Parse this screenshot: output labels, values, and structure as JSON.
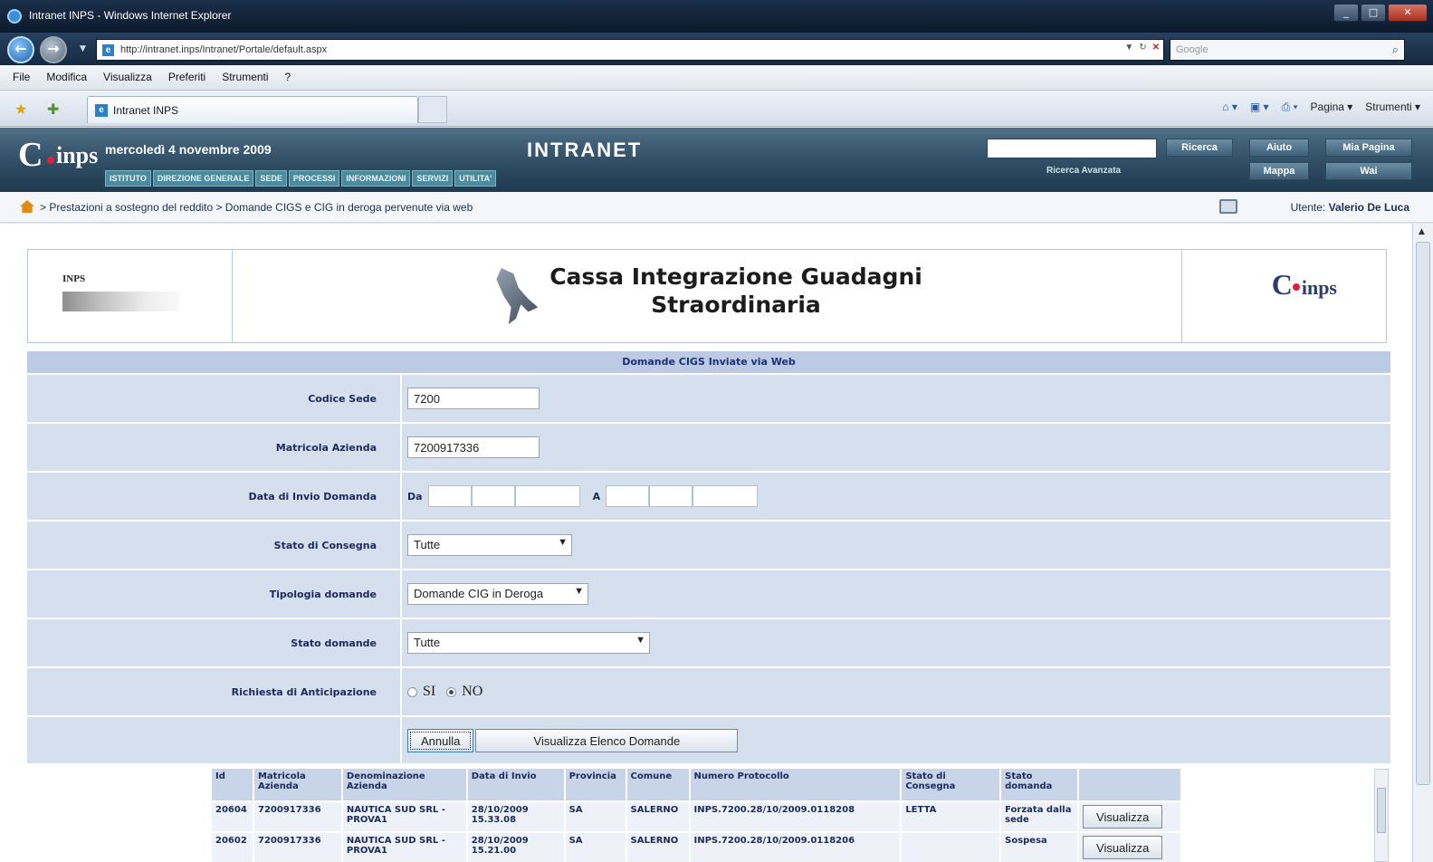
{
  "browser": {
    "window_title": "Intranet INPS - Windows Internet Explorer",
    "url": "http://intranet.inps/Intranet/Portale/default.aspx",
    "search_placeholder": "Google",
    "menu": [
      "File",
      "Modifica",
      "Visualizza",
      "Preferiti",
      "Strumenti",
      "?"
    ],
    "tab_label": "Intranet INPS",
    "command_bar": [
      "Pagina ▾",
      "Strumenti ▾"
    ]
  },
  "header": {
    "logo_text": "e-inps",
    "date": "mercoledì 4 novembre 2009",
    "title": "INTRANET",
    "nav": [
      "ISTITUTO",
      "DIREZIONE GENERALE",
      "SEDE",
      "PROCESSI",
      "INFORMAZIONI",
      "SERVIZI",
      "UTILITA'"
    ],
    "search_button": "Ricerca",
    "advanced_search": "Ricerca Avanzata",
    "help": "Aiuto",
    "my_page": "Mia Pagina",
    "map": "Mappa",
    "wai": "Wai"
  },
  "breadcrumb": {
    "path": "> Prestazioni a sostegno del reddito > Domande CIGS e CIG in deroga pervenute via web",
    "user_label": "Utente:",
    "user_name": "Valerio De Luca"
  },
  "banner": {
    "left_logo_text": "INPS",
    "title_line1": "Cassa Integrazione Guadagni",
    "title_line2": "Straordinaria",
    "right_logo_text": "e-inps"
  },
  "form": {
    "heading": "Domande CIGS Inviate via Web",
    "codice_sede_label": "Codice Sede",
    "codice_sede_value": "7200",
    "matricola_label": "Matricola Azienda",
    "matricola_value": "7200917336",
    "data_invio_label": "Data di Invio Domanda",
    "da_label": "Da",
    "a_label": "A",
    "stato_consegna_label": "Stato di Consegna",
    "stato_consegna_value": "Tutte",
    "tipologia_label": "Tipologia domande",
    "tipologia_value": "Domande CIG in Deroga",
    "stato_domande_label": "Stato domande",
    "stato_domande_value": "Tutte",
    "anticipazione_label": "Richiesta di Anticipazione",
    "si_label": "SI",
    "no_label": "NO",
    "annulla_button": "Annulla",
    "visualizza_elenco_button": "Visualizza Elenco Domande"
  },
  "results": {
    "columns": [
      "Id",
      "Matricola Azienda",
      "Denominazione Azienda",
      "Data di Invio",
      "Provincia",
      "Comune",
      "Numero Protocollo",
      "Stato di Consegna",
      "Stato domanda",
      ""
    ],
    "rows": [
      {
        "id": "20604",
        "matricola": "7200917336",
        "denominazione": "NAUTICA SUD SRL - PROVA1",
        "data_invio": "28/10/2009 15.33.08",
        "provincia": "SA",
        "comune": "SALERNO",
        "protocollo": "INPS.7200.28/10/2009.0118208",
        "stato_consegna": "LETTA",
        "stato_domanda": "Forzata dalla sede",
        "action": "Visualizza"
      },
      {
        "id": "20602",
        "matricola": "7200917336",
        "denominazione": "NAUTICA SUD SRL - PROVA1",
        "data_invio": "28/10/2009 15.21.00",
        "provincia": "SA",
        "comune": "SALERNO",
        "protocollo": "INPS.7200.28/10/2009.0118206",
        "stato_consegna": "",
        "stato_domanda": "Sospesa",
        "action": "Visualizza"
      }
    ]
  }
}
